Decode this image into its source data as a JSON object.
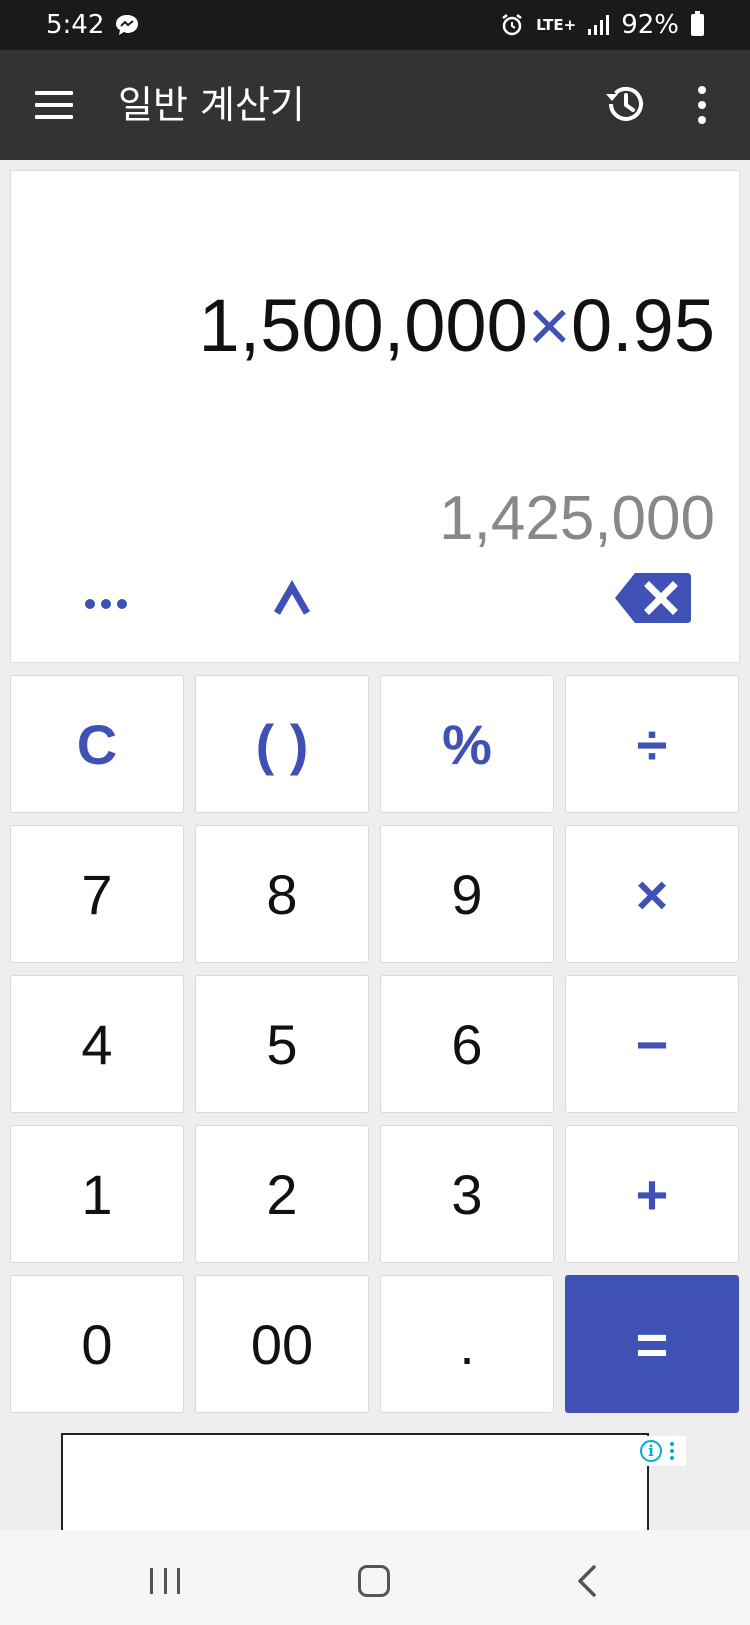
{
  "status_bar": {
    "time": "5:42",
    "network": "LTE+",
    "battery": "92%"
  },
  "app_bar": {
    "title": "일반 계산기"
  },
  "display": {
    "expression_left": "1,500,000",
    "expression_operator": "×",
    "expression_right": "0.95",
    "result": "1,425,000"
  },
  "keypad": {
    "rows": [
      [
        "C",
        "( )",
        "%",
        "÷"
      ],
      [
        "7",
        "8",
        "9",
        "×"
      ],
      [
        "4",
        "5",
        "6",
        "−"
      ],
      [
        "1",
        "2",
        "3",
        "+"
      ],
      [
        "0",
        "00",
        ".",
        "="
      ]
    ]
  },
  "ad": {
    "info_glyph": "i"
  },
  "colors": {
    "accent": "#3f51b5",
    "app_bar": "#333333",
    "status_bar": "#1a1a1a",
    "result_text": "#888888",
    "ad_accent": "#00aecd"
  },
  "icons": {
    "menu": "menu-icon",
    "history": "history-icon",
    "more": "more-vert-icon",
    "backspace": "backspace-icon",
    "expand": "caret-up-icon",
    "options": "more-horiz-icon"
  }
}
